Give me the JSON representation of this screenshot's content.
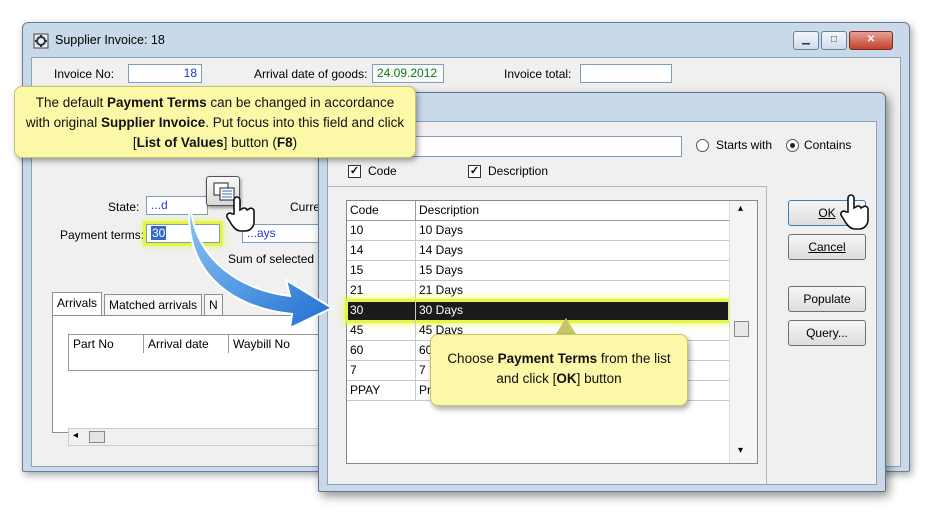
{
  "main_window": {
    "title": "Supplier Invoice: 18",
    "invoice_no_label": "Invoice No:",
    "invoice_no_value": "18",
    "arrival_date_label": "Arrival date of goods:",
    "arrival_date_value": "24.09.2012",
    "invoice_total_label": "Invoice total:",
    "invoice_total_value": "",
    "state_label": "State:",
    "state_value": "...d",
    "currency_label": "Curre",
    "payment_terms_label": "Payment terms:",
    "payment_terms_value": "30",
    "payment_terms_desc": "...ays",
    "sum_selected_label": "Sum of selected li",
    "tabs": [
      "Arrivals",
      "Matched arrivals",
      "N"
    ],
    "grid_headers": [
      "Part No",
      "Arrival date",
      "Waybill No"
    ]
  },
  "lov_dialog": {
    "search_value": "",
    "starts_with_label": "Starts with",
    "contains_label": "Contains",
    "code_checkbox_label": "Code",
    "description_checkbox_label": "Description",
    "ok_label": "OK",
    "cancel_label": "Cancel",
    "populate_label": "Populate",
    "query_label": "Query...",
    "columns": [
      "Code",
      "Description"
    ],
    "rows": [
      {
        "code": "10",
        "desc": "10 Days"
      },
      {
        "code": "14",
        "desc": "14 Days"
      },
      {
        "code": "15",
        "desc": "15 Days"
      },
      {
        "code": "21",
        "desc": "21 Days"
      },
      {
        "code": "30",
        "desc": "30 Days"
      },
      {
        "code": "45",
        "desc": "45 Days"
      },
      {
        "code": "60",
        "desc": "60"
      },
      {
        "code": "7",
        "desc": "7"
      },
      {
        "code": "PPAY",
        "desc": "Pr"
      }
    ]
  },
  "callouts": {
    "top_part1": "The default ",
    "top_bold1": "Payment Terms",
    "top_part2": " can be changed in accordance with original ",
    "top_bold2": "Supplier Invoice",
    "top_part3": ".  Put focus into this field and click [",
    "top_bold3": "List of Values",
    "top_part4": "] button (",
    "top_bold4": "F8",
    "top_part5": ")",
    "bottom_part1": "Choose ",
    "bottom_bold1": "Payment Terms",
    "bottom_part2": " from the list and click [",
    "bottom_bold2": "OK",
    "bottom_part3": "] button"
  },
  "colors": {
    "highlight": "#e4f542",
    "callout_bg": "#fbf9a8",
    "arrow": "#2f8be0"
  }
}
